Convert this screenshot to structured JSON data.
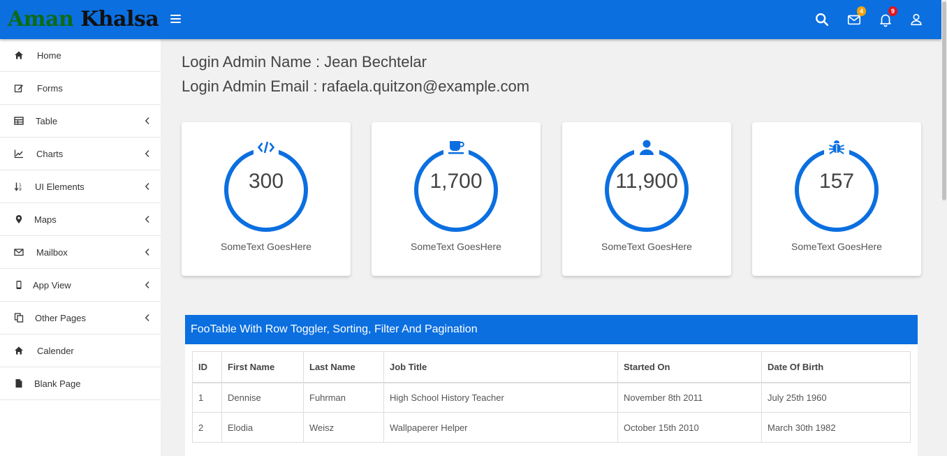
{
  "brand": {
    "part1": "Aman",
    "part2": "Khalsa"
  },
  "topbar": {
    "icons": [
      "search-icon",
      "mail-icon",
      "bell-icon",
      "user-icon"
    ],
    "mail_badge": "4",
    "bell_badge": "9",
    "colors": {
      "bar": "#0b6fe0",
      "mail_badge": "#f0a30a",
      "bell_badge": "#e3141e"
    }
  },
  "sidebar": {
    "items": [
      {
        "label": "Home",
        "icon": "home-icon",
        "has_submenu": false
      },
      {
        "label": "Forms",
        "icon": "edit-icon",
        "has_submenu": false
      },
      {
        "label": "Table",
        "icon": "table-icon",
        "has_submenu": true
      },
      {
        "label": "Charts",
        "icon": "line-chart-icon",
        "has_submenu": true
      },
      {
        "label": "UI Elements",
        "icon": "sort-icon",
        "has_submenu": true
      },
      {
        "label": "Maps",
        "icon": "map-marker-icon",
        "has_submenu": true
      },
      {
        "label": "Mailbox",
        "icon": "envelope-icon",
        "has_submenu": true
      },
      {
        "label": "App View",
        "icon": "mobile-icon",
        "has_submenu": true
      },
      {
        "label": "Other Pages",
        "icon": "copy-icon",
        "has_submenu": true
      },
      {
        "label": "Calender",
        "icon": "home-icon",
        "has_submenu": false
      },
      {
        "label": "Blank Page",
        "icon": "file-icon",
        "has_submenu": false
      }
    ]
  },
  "login": {
    "name_line": "Login Admin Name : Jean Bechtelar",
    "email_line": "Login Admin Email : rafaela.quitzon@example.com"
  },
  "cards": [
    {
      "value": "300",
      "caption": "SomeText GoesHere",
      "icon": "code-icon"
    },
    {
      "value": "1,700",
      "caption": "SomeText GoesHere",
      "icon": "coffee-icon"
    },
    {
      "value": "11,900",
      "caption": "SomeText GoesHere",
      "icon": "user-icon"
    },
    {
      "value": "157",
      "caption": "SomeText GoesHere",
      "icon": "bug-icon"
    }
  ],
  "table": {
    "title": "FooTable With Row Toggler, Sorting, Filter And Pagination",
    "columns": [
      "ID",
      "First Name",
      "Last Name",
      "Job Title",
      "Started On",
      "Date Of Birth"
    ],
    "rows": [
      [
        "1",
        "Dennise",
        "Fuhrman",
        "High School History Teacher",
        "November 8th 2011",
        "July 25th 1960"
      ],
      [
        "2",
        "Elodia",
        "Weisz",
        "Wallpaperer Helper",
        "October 15th 2010",
        "March 30th 1982"
      ]
    ]
  },
  "accent_color": "#0b6fe0"
}
